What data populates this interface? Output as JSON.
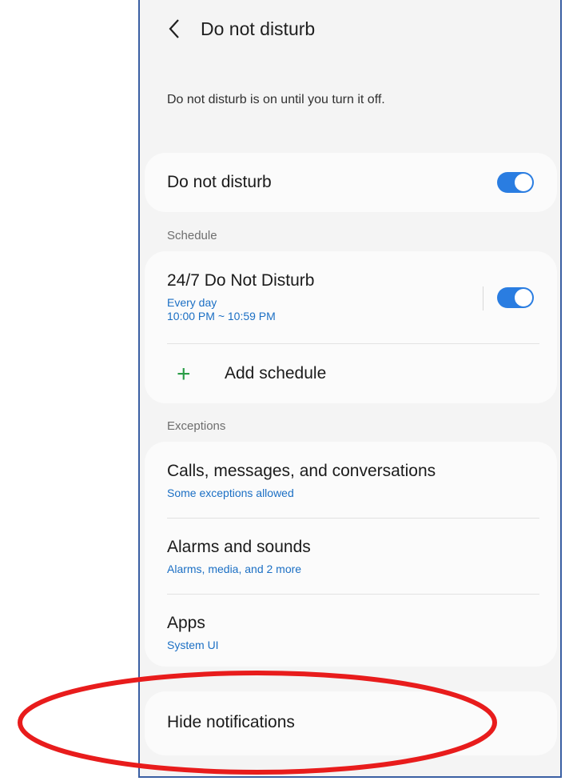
{
  "header": {
    "title": "Do not disturb"
  },
  "description": "Do not disturb is on until you turn it off.",
  "main_toggle": {
    "label": "Do not disturb",
    "state": "on"
  },
  "schedule": {
    "section_label": "Schedule",
    "item": {
      "title": "24/7 Do Not Disturb",
      "days": "Every day",
      "time": "10:00 PM ~ 10:59 PM",
      "state": "on"
    },
    "add_label": "Add schedule"
  },
  "exceptions": {
    "section_label": "Exceptions",
    "items": [
      {
        "title": "Calls, messages, and conversations",
        "subtitle": "Some exceptions allowed"
      },
      {
        "title": "Alarms and sounds",
        "subtitle": "Alarms, media, and 2 more"
      },
      {
        "title": "Apps",
        "subtitle": "System UI"
      }
    ]
  },
  "hide_notifications": {
    "label": "Hide notifications"
  },
  "colors": {
    "accent": "#2a7de1",
    "add_icon": "#2a9d47",
    "annotation": "#e81c1c",
    "frame": "#3a5fa3"
  },
  "icons": [
    "back-icon",
    "plus-icon"
  ]
}
